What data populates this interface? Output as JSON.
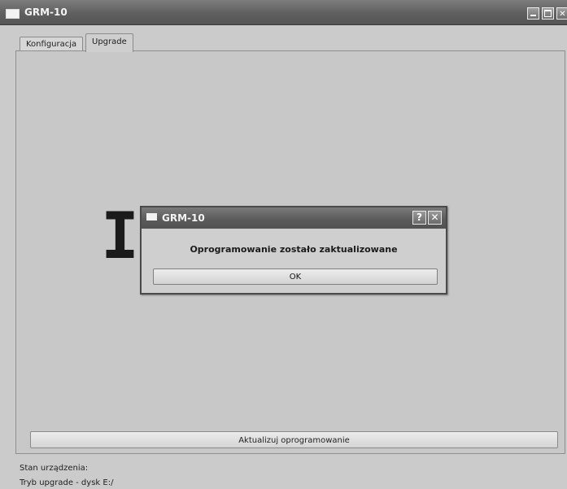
{
  "window": {
    "title": "GRM-10",
    "minimize_icon": "minimize-icon",
    "maximize_icon": "maximize-icon",
    "close_glyph": "✕"
  },
  "tabs": [
    {
      "label": "Konfiguracja",
      "active": false
    },
    {
      "label": "Upgrade",
      "active": true
    }
  ],
  "main": {
    "background_label_left": "I",
    "background_label_right": ":",
    "update_button": "Aktualizuj oprogramowanie"
  },
  "status": {
    "line1": "Stan urządzenia:",
    "line2": "Tryb upgrade - dysk E:/"
  },
  "dialog": {
    "title": "GRM-10",
    "help_glyph": "?",
    "close_glyph": "✕",
    "message": "Oprogramowanie zostało zaktualizowane",
    "ok_label": "OK"
  }
}
